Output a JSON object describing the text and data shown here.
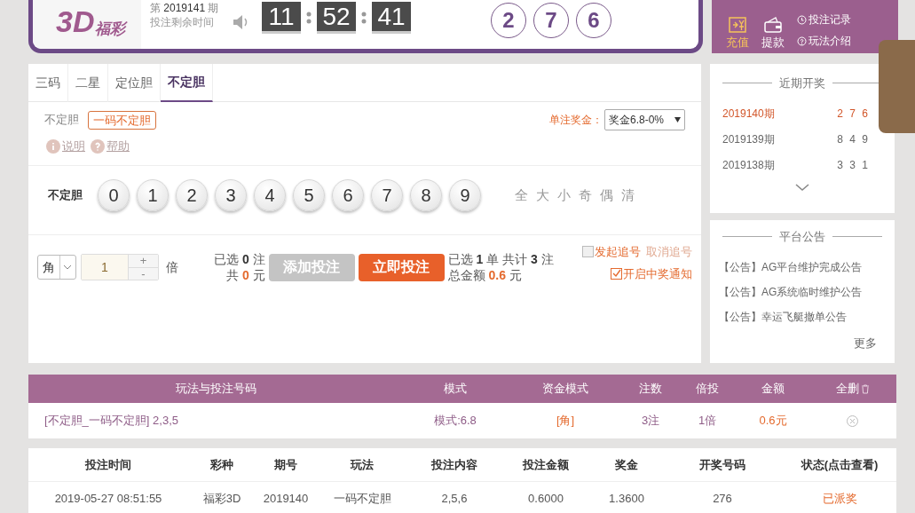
{
  "header": {
    "logo": {
      "numeral": "3D",
      "text": "福彩"
    },
    "issue": {
      "prefix": "第",
      "number": "2019141",
      "suffix": "期"
    },
    "countdown_label": "投注剩余时间",
    "timer": [
      "11",
      "52",
      "41"
    ],
    "last_result": [
      "2",
      "7",
      "6"
    ]
  },
  "account": {
    "actions": [
      {
        "label": "充值",
        "kind": "recharge",
        "selected": true
      },
      {
        "label": "提款",
        "kind": "withdraw",
        "selected": false
      }
    ],
    "links": [
      {
        "label": "投注记录",
        "kind": "record"
      },
      {
        "label": "玩法介绍",
        "kind": "help"
      }
    ]
  },
  "tabs": [
    {
      "label": "三码",
      "selected": false
    },
    {
      "label": "二星",
      "selected": false
    },
    {
      "label": "定位胆",
      "selected": false
    },
    {
      "label": "不定胆",
      "selected": true
    }
  ],
  "subtype": {
    "label": "不定胆",
    "options": [
      {
        "label": "一码不定胆",
        "selected": true
      }
    ]
  },
  "prize": {
    "label": "单注奖金：",
    "value": "奖金6.8-0%"
  },
  "info_links": [
    {
      "label": "说明",
      "kind": "info"
    },
    {
      "label": "帮助",
      "kind": "help"
    }
  ],
  "ball_row": {
    "label": "不定胆",
    "balls": [
      {
        "label": "0",
        "selected": false
      },
      {
        "label": "1",
        "selected": false
      },
      {
        "label": "2",
        "selected": false
      },
      {
        "label": "3",
        "selected": false
      },
      {
        "label": "4",
        "selected": false
      },
      {
        "label": "5",
        "selected": false
      },
      {
        "label": "6",
        "selected": false
      },
      {
        "label": "7",
        "selected": false
      },
      {
        "label": "8",
        "selected": false
      },
      {
        "label": "9",
        "selected": false
      }
    ],
    "tools": [
      "全",
      "大",
      "小",
      "奇",
      "偶",
      "清"
    ]
  },
  "bet_controls": {
    "unit": "角",
    "multiplier": "1",
    "plus": "+",
    "minus": "-",
    "multiplier_unit": "倍",
    "selection": {
      "prefix": "已选",
      "count": "0",
      "count_unit": "注",
      "total_prefix": "共",
      "total": "0",
      "total_unit": "元"
    },
    "add_button": {
      "label": "添加投注",
      "disabled": true
    },
    "submit_button": "立即投注",
    "summary": {
      "prefix": "已选",
      "orders": "1",
      "orders_unit": "单 共计",
      "bets": "3",
      "bets_unit": "注",
      "amount_label": "总金额",
      "amount": "0.6",
      "amount_unit": "元"
    },
    "options": [
      {
        "label": "发起追号",
        "checked": false
      },
      {
        "label": "开启中奖通知",
        "checked": true
      }
    ],
    "cancel_chase": "取消追号"
  },
  "recent_draws": {
    "title": "近期开奖",
    "rows": [
      {
        "issue": "2019140期",
        "numbers": "2 7 6",
        "latest": true
      },
      {
        "issue": "2019139期",
        "numbers": "8 4 9",
        "latest": false
      },
      {
        "issue": "2019138期",
        "numbers": "3 3 1",
        "latest": false
      }
    ]
  },
  "announcements": {
    "title": "平台公告",
    "items": [
      "【公告】AG平台维护完成公告",
      "【公告】AG系统临时维护公告",
      "【公告】幸运飞艇撤单公告"
    ],
    "more": "更多"
  },
  "bet_list": {
    "columns": [
      "玩法与投注号码",
      "模式",
      "资金模式",
      "注数",
      "倍投",
      "金额",
      "全删"
    ],
    "rows": [
      {
        "play": "[不定胆_一码不定胆] 2,3,5",
        "mode": "模式:6.8",
        "money_mode": "[角]",
        "bets": "3注",
        "multiple": "1倍",
        "amount": "0.6元"
      }
    ]
  },
  "history": {
    "columns": [
      "投注时间",
      "彩种",
      "期号",
      "玩法",
      "投注内容",
      "投注金额",
      "奖金",
      "开奖号码",
      "状态(点击查看)"
    ],
    "rows": [
      [
        "2019-05-27 08:51:55",
        "福彩3D",
        "2019140",
        "一码不定胆",
        "2,5,6",
        "0.6000",
        "1.3600",
        "276",
        "已派奖"
      ]
    ]
  }
}
